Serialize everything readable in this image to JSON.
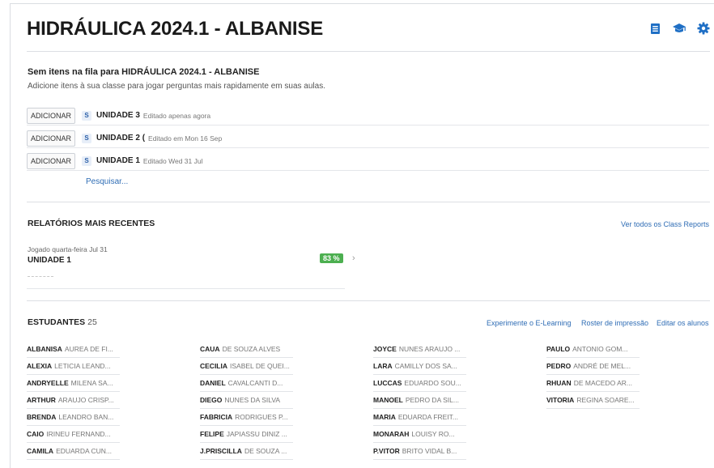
{
  "header": {
    "title": "HIDRÁULICA 2024.1 - ALBANISE",
    "icons": [
      "document-icon",
      "graduation-cap-icon",
      "gear-icon"
    ],
    "accent_color": "#1f6fc5"
  },
  "queue": {
    "empty_title": "Sem itens na fila para HIDRÁULICA 2024.1 - ALBANISE",
    "empty_subtitle": "Adicione itens à sua classe para jogar perguntas mais rapidamente em suas aulas.",
    "items": [
      {
        "add_label": "ADICIONAR",
        "badge": "S",
        "name": "UNIDADE 3",
        "edited": "Editado apenas agora"
      },
      {
        "add_label": "ADICIONAR",
        "badge": "S",
        "name": "UNIDADE 2 (",
        "edited": "Editado em Mon 16 Sep"
      },
      {
        "add_label": "ADICIONAR",
        "badge": "S",
        "name": "UNIDADE 1",
        "edited": "Editado Wed 31 Jul"
      }
    ],
    "search_label": "Pesquisar..."
  },
  "reports": {
    "title": "RELATÓRIOS MAIS RECENTES",
    "view_all": "Ver todos os Class Reports",
    "items": [
      {
        "played": "Jogado quarta-feira Jul 31",
        "name": "UNIDADE 1",
        "score": "83 %"
      }
    ],
    "score_color": "#4caf50"
  },
  "students": {
    "title": "ESTUDANTES",
    "count": "25",
    "actions": {
      "elearning": "Experimente o E-Learning",
      "roster": "Roster de impressão",
      "edit": "Editar os alunos"
    },
    "columns": [
      [
        {
          "first": "ALBANISA",
          "rest": "AUREA DE FI..."
        },
        {
          "first": "ALEXIA",
          "rest": "LETICIA LEAND..."
        },
        {
          "first": "ANDRYELLE",
          "rest": "MILENA SA..."
        },
        {
          "first": "ARTHUR",
          "rest": "ARAUJO CRISP..."
        },
        {
          "first": "BRENDA",
          "rest": "LEANDRO BAN..."
        },
        {
          "first": "CAIO",
          "rest": "IRINEU FERNAND..."
        },
        {
          "first": "CAMILA",
          "rest": "EDUARDA CUN..."
        }
      ],
      [
        {
          "first": "CAUA",
          "rest": "DE SOUZA ALVES"
        },
        {
          "first": "CECILIA",
          "rest": "ISABEL DE QUEI..."
        },
        {
          "first": "DANIEL",
          "rest": "CAVALCANTI D..."
        },
        {
          "first": "DIEGO",
          "rest": "NUNES DA SILVA"
        },
        {
          "first": "FABRICIA",
          "rest": "RODRIGUES P..."
        },
        {
          "first": "FELIPE",
          "rest": "JAPIASSU DINIZ ..."
        },
        {
          "first": "J.PRISCILLA",
          "rest": "DE SOUZA ..."
        }
      ],
      [
        {
          "first": "JOYCE",
          "rest": "NUNES ARAUJO ..."
        },
        {
          "first": "LARA",
          "rest": "CAMILLY DOS SA..."
        },
        {
          "first": "LUCCAS",
          "rest": "EDUARDO SOU..."
        },
        {
          "first": "MANOEL",
          "rest": "PEDRO DA SIL..."
        },
        {
          "first": "MARIA",
          "rest": "EDUARDA FREIT..."
        },
        {
          "first": "MONARAH",
          "rest": "LOUISY RO..."
        },
        {
          "first": "P.VITOR",
          "rest": "BRITO VIDAL B..."
        }
      ],
      [
        {
          "first": "PAULO",
          "rest": "ANTONIO GOM..."
        },
        {
          "first": "PEDRO",
          "rest": "ANDRÉ DE MEL..."
        },
        {
          "first": "RHUAN",
          "rest": "DE MACEDO AR..."
        },
        {
          "first": "VITORIA",
          "rest": "REGINA SOARE..."
        }
      ]
    ]
  }
}
